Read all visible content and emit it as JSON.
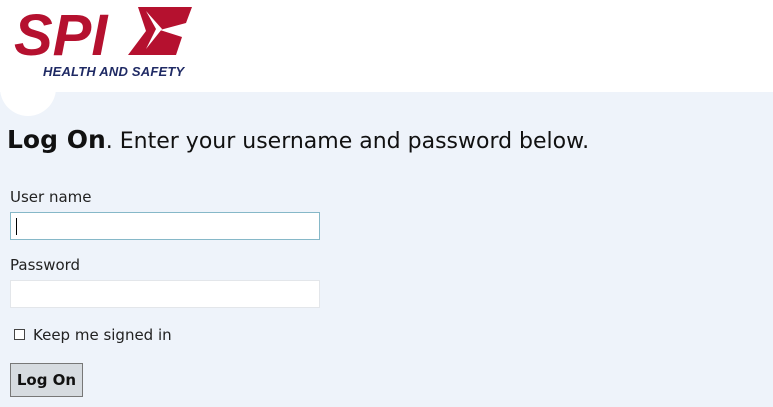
{
  "brand": {
    "logo_text": "SPI",
    "tagline": "HEALTH AND SAFETY",
    "primary_color": "#b5112f",
    "secondary_color": "#1f2a64"
  },
  "page": {
    "title_strong": "Log On",
    "title_rest": ". Enter your username and password below."
  },
  "form": {
    "username_label": "User name",
    "username_value": "",
    "password_label": "Password",
    "password_value": "",
    "remember_label": "Keep me signed in",
    "remember_checked": false,
    "submit_label": "Log On"
  }
}
